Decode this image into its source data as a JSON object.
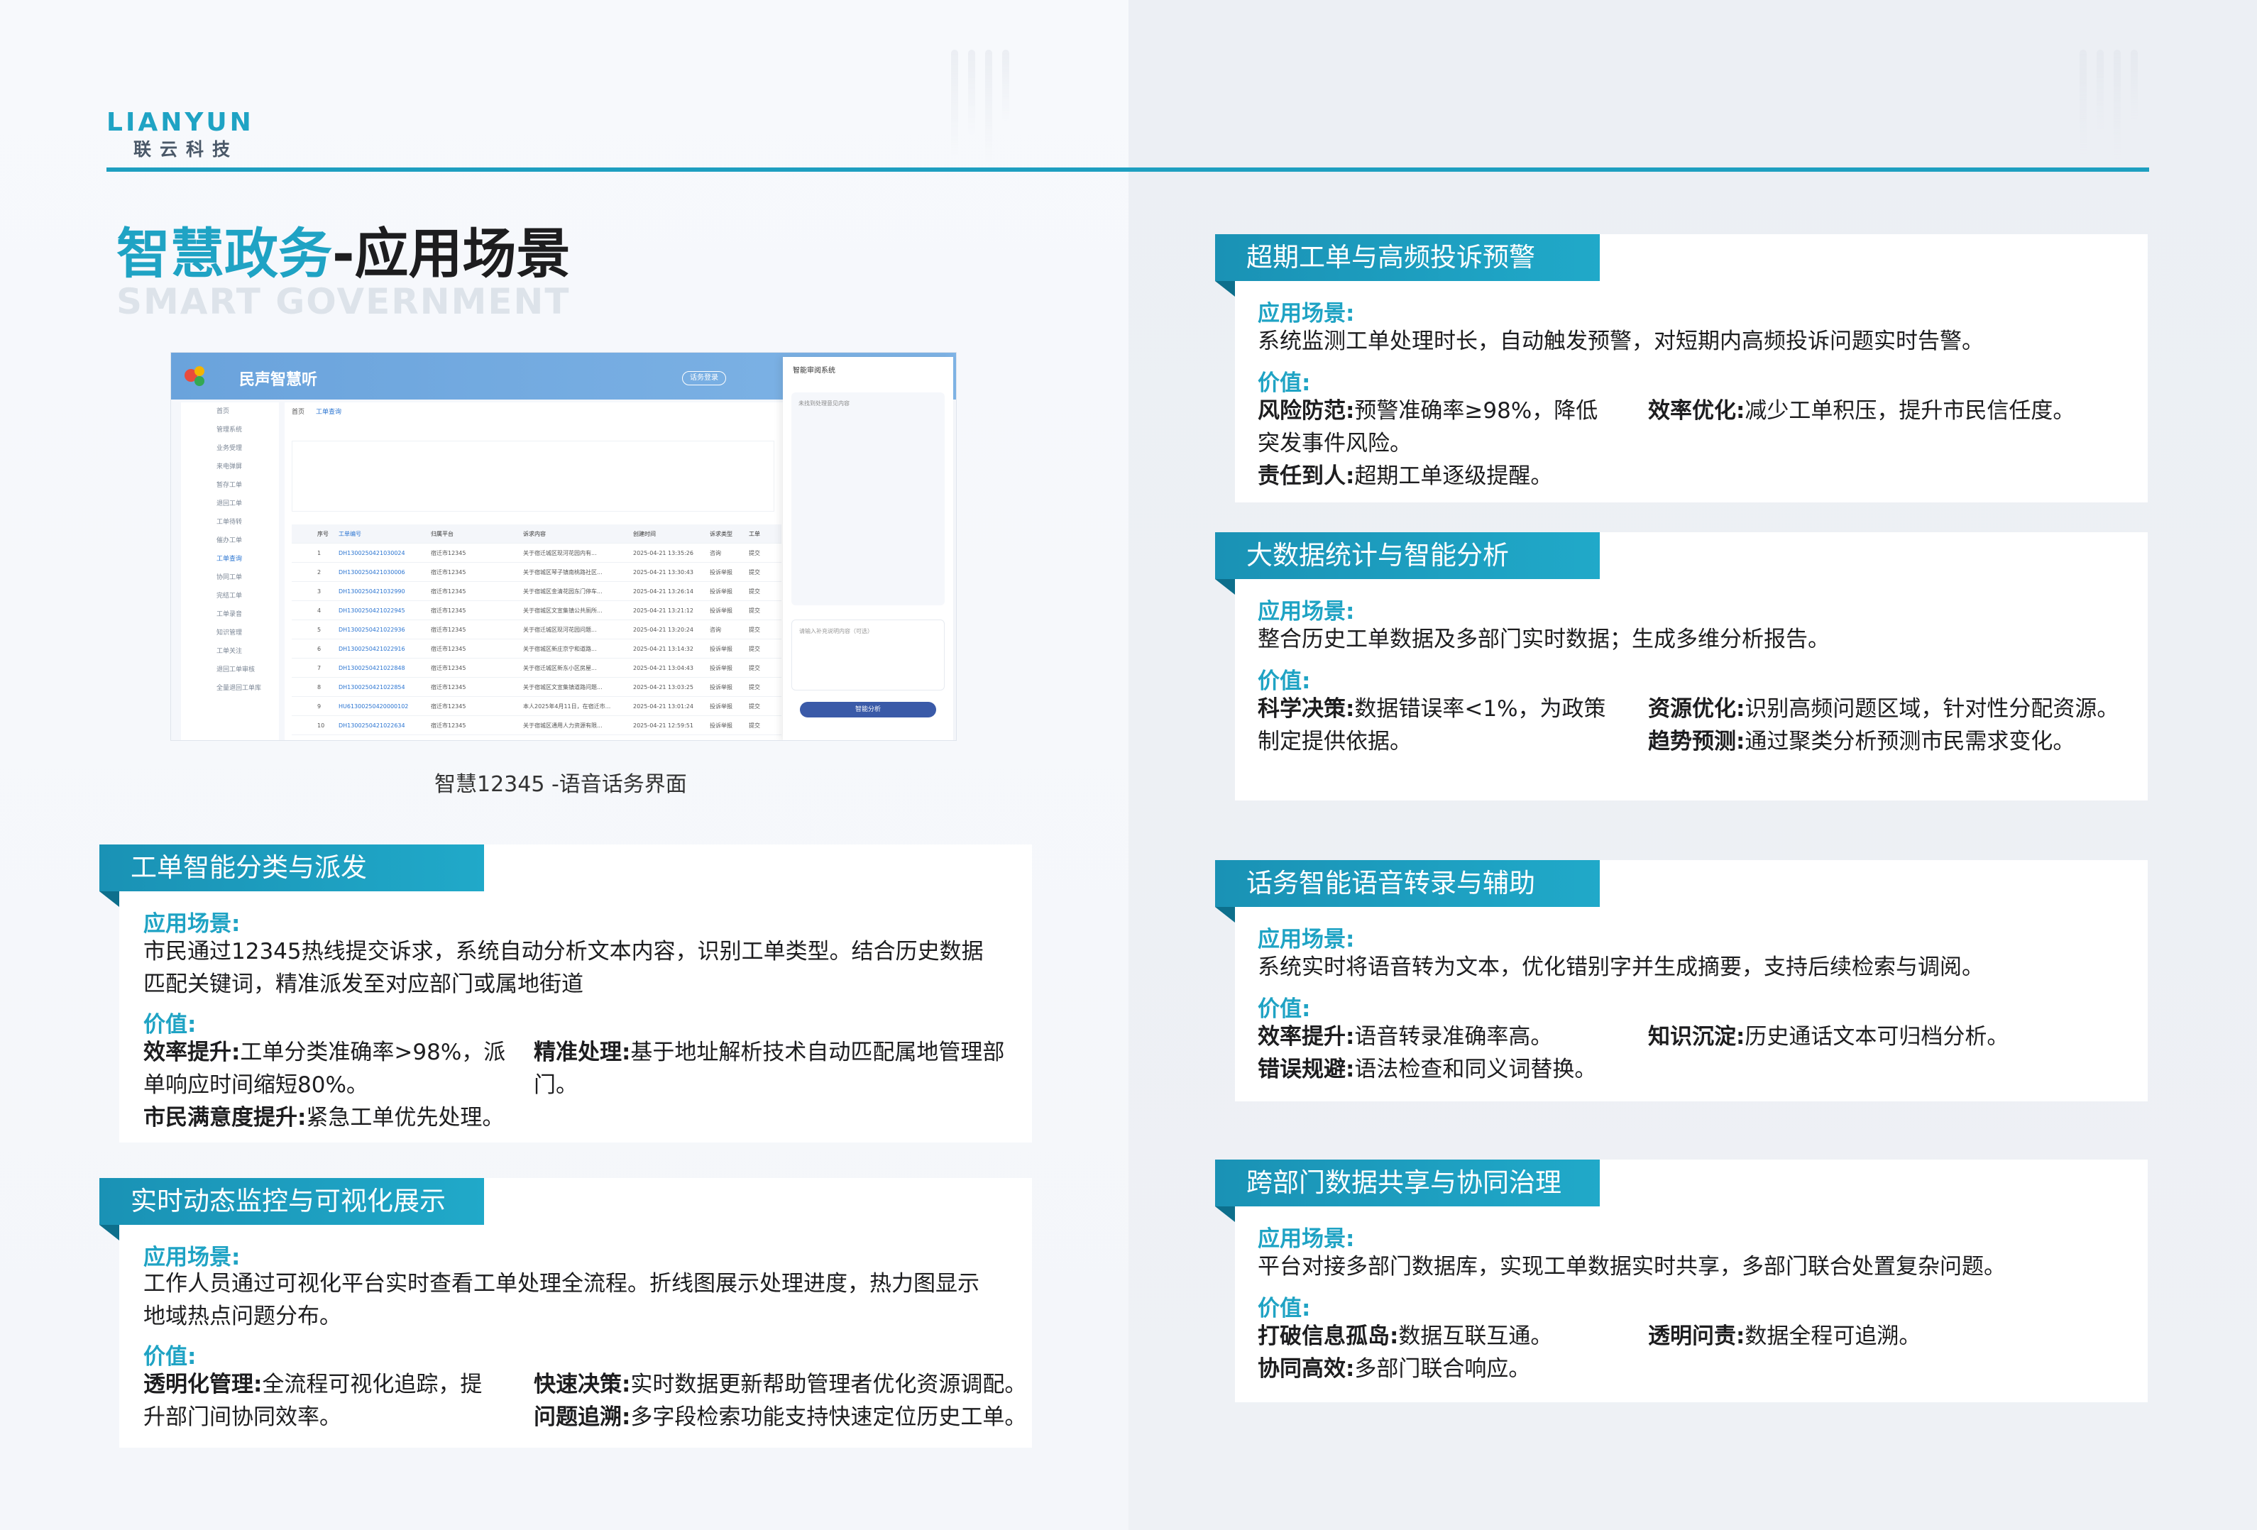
{
  "brand": {
    "logo_text": "LIANYUN",
    "logo_cn": "联云科技"
  },
  "title": {
    "accent": "智慧政务",
    "rest": "-应用场景",
    "subtitle": "SMART GOVERNMENT"
  },
  "screenshot": {
    "app_name": "民声智慧听",
    "header_button": "话务登录",
    "tabs": [
      "首页",
      "工单查询"
    ],
    "sidebar_items": [
      "首页",
      "管理系统",
      "业务受理",
      "来电弹屏",
      "暂存工单",
      "退回工单",
      "工单待转",
      "催办工单",
      "工单查询",
      "协同工单",
      "完结工单",
      "工单录音",
      "知识管理",
      "工单关注",
      "退回工单审核",
      "全量退回工单库"
    ],
    "table_headers": [
      "",
      "序号",
      "工单编号",
      "归属平台",
      "诉求内容",
      "创建时间",
      "诉求类型",
      "工单"
    ],
    "table_rows": [
      [
        "",
        "1",
        "DH1300250421030024",
        "宿迁市12345",
        "关于宿迁城区现河花园内有...",
        "2025-04-21 13:35:26",
        "咨询",
        "提交"
      ],
      [
        "",
        "2",
        "DH1300250421030006",
        "宿迁市12345",
        "关于宿城区琴子镇南桃路社区...",
        "2025-04-21 13:30:43",
        "投诉举报",
        "提交"
      ],
      [
        "",
        "3",
        "DH1300250421032990",
        "宿迁市12345",
        "关于宿城区金清花园东门停车...",
        "2025-04-21 13:26:14",
        "投诉举报",
        "提交"
      ],
      [
        "",
        "4",
        "DH1300250421022945",
        "宿迁市12345",
        "关于宿城区文宣集镇公共厕所...",
        "2025-04-21 13:21:12",
        "投诉举报",
        "提交"
      ],
      [
        "",
        "5",
        "DH1300250421022936",
        "宿迁市12345",
        "关于宿迁城区现河花园问题...",
        "2025-04-21 13:20:24",
        "咨询",
        "提交"
      ],
      [
        "",
        "6",
        "DH1300250421022916",
        "宿迁市12345",
        "关于宿城区新庄京宁和道路...",
        "2025-04-21 13:14:32",
        "投诉举报",
        "提交"
      ],
      [
        "",
        "7",
        "DH1300250421022848",
        "宿迁市12345",
        "关于宿迁城区新东小区房屋...",
        "2025-04-21 13:04:43",
        "投诉举报",
        "提交"
      ],
      [
        "",
        "8",
        "DH1300250421022854",
        "宿迁市12345",
        "关于宿城区文宣集镇道路问题...",
        "2025-04-21 13:03:25",
        "投诉举报",
        "提交"
      ],
      [
        "",
        "9",
        "HU61300250420000102",
        "宿迁市12345",
        "本人2025年4月11日，在宿迁市...",
        "2025-04-21 13:01:24",
        "投诉举报",
        "提交"
      ],
      [
        "",
        "10",
        "DH1300250421022634",
        "宿迁市12345",
        "关于宿城区通用人力资源有限...",
        "2025-04-21 12:59:51",
        "投诉举报",
        "提交"
      ]
    ],
    "panel_title": "智能审阅系统",
    "panel_placeholder": "未找到处理意见内容",
    "panel_input_placeholder": "请输入补充说明内容（可选）",
    "panel_button": "智能分析"
  },
  "caption": "智慧12345 -语音话务界面",
  "common": {
    "scene_label": "应用场景:",
    "value_label": "价值:"
  },
  "cards": [
    {
      "title": "工单智能分类与派发",
      "scene": "市民通过12345热线提交诉求，系统自动分析文本内容，识别工单类型。结合历史数据匹配关键词，精准派发至对应部门或属地街道",
      "values": [
        {
          "key": "效率提升:",
          "text": "工单分类准确率>98%，派单响应时间缩短80%。"
        },
        {
          "key": "精准处理:",
          "text": "基于地址解析技术自动匹配属地管理部门。"
        },
        {
          "key": "市民满意度提升:",
          "text": "紧急工单优先处理。"
        }
      ]
    },
    {
      "title": "实时动态监控与可视化展示",
      "scene": "工作人员通过可视化平台实时查看工单处理全流程。折线图展示处理进度，热力图显示地域热点问题分布。",
      "values": [
        {
          "key": "透明化管理:",
          "text": "全流程可视化追踪，提升部门间协同效率。"
        },
        {
          "key": "快速决策:",
          "text": "实时数据更新帮助管理者优化资源调配。"
        },
        {
          "key": "问题追溯:",
          "text": "多字段检索功能支持快速定位历史工单。"
        }
      ]
    },
    {
      "title": "超期工单与高频投诉预警",
      "scene": "系统监测工单处理时长，自动触发预警，对短期内高频投诉问题实时告警。",
      "values": [
        {
          "key": "风险防范:",
          "text": "预警准确率≥98%，降低突发事件风险。"
        },
        {
          "key": "效率优化:",
          "text": "减少工单积压，提升市民信任度。"
        },
        {
          "key": "责任到人:",
          "text": "超期工单逐级提醒。"
        }
      ]
    },
    {
      "title": "大数据统计与智能分析",
      "scene": "整合历史工单数据及多部门实时数据；生成多维分析报告。",
      "values": [
        {
          "key": "科学决策:",
          "text": "数据错误率<1%，为政策制定提供依据。"
        },
        {
          "key": "资源优化:",
          "text": "识别高频问题区域，针对性分配资源。"
        },
        {
          "key": "趋势预测:",
          "text": "通过聚类分析预测市民需求变化。"
        }
      ]
    },
    {
      "title": "话务智能语音转录与辅助",
      "scene": "系统实时将语音转为文本，优化错别字并生成摘要，支持后续检索与调阅。",
      "values": [
        {
          "key": "效率提升:",
          "text": "语音转录准确率高。"
        },
        {
          "key": "知识沉淀:",
          "text": "历史通话文本可归档分析。"
        },
        {
          "key": "错误规避:",
          "text": "语法检查和同义词替换。"
        }
      ]
    },
    {
      "title": "跨部门数据共享与协同治理",
      "scene": "平台对接多部门数据库，实现工单数据实时共享，多部门联合处置复杂问题。",
      "values": [
        {
          "key": "打破信息孤岛:",
          "text": "数据互联互通。"
        },
        {
          "key": "透明问责:",
          "text": "数据全程可追溯。"
        },
        {
          "key": "协同高效:",
          "text": "多部门联合响应。"
        }
      ]
    }
  ],
  "colors": {
    "accent": "#1fa3c4",
    "tag": "#1a92b5",
    "header_line": "#1e9fc0"
  }
}
